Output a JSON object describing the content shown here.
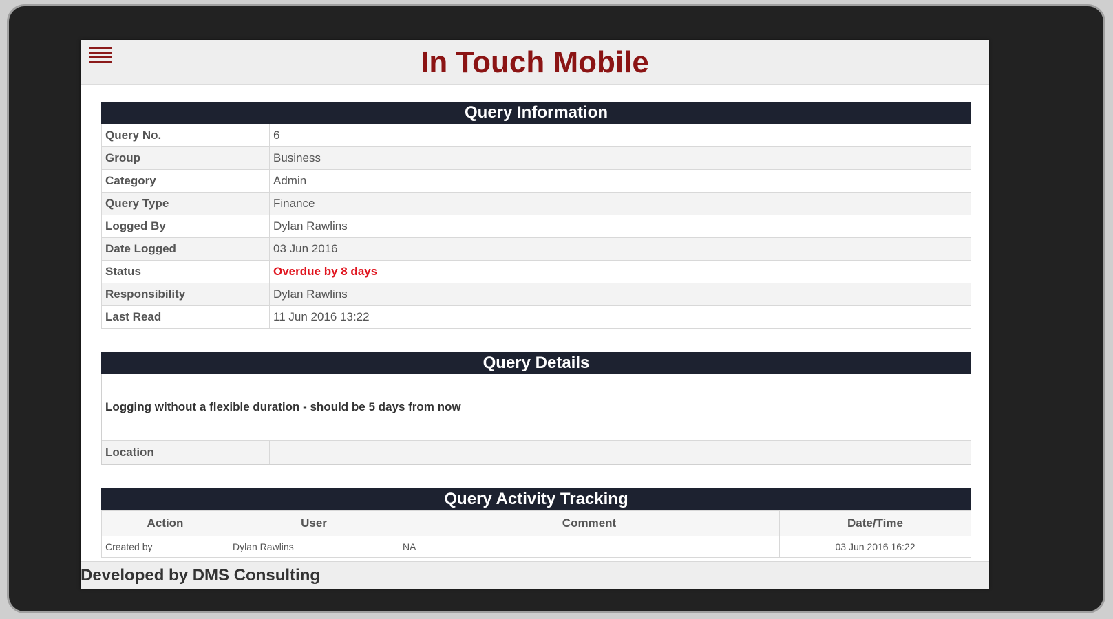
{
  "app": {
    "title": "In Touch Mobile",
    "menu_icon": "hamburger-menu-icon",
    "accent_color": "#8b1414",
    "header_color": "#1d2230"
  },
  "query_information": {
    "header": "Query Information",
    "rows": [
      {
        "label": "Query No.",
        "value": "6"
      },
      {
        "label": "Group",
        "value": "Business"
      },
      {
        "label": "Category",
        "value": "Admin"
      },
      {
        "label": "Query Type",
        "value": "Finance"
      },
      {
        "label": "Logged By",
        "value": "Dylan Rawlins"
      },
      {
        "label": "Date Logged",
        "value": "03 Jun 2016"
      },
      {
        "label": "Status",
        "value": "Overdue by 8 days"
      },
      {
        "label": "Responsibility",
        "value": "Dylan Rawlins"
      },
      {
        "label": "Last Read",
        "value": "11 Jun 2016 13:22"
      }
    ]
  },
  "query_details": {
    "header": "Query Details",
    "description": "Logging without a flexible duration - should be 5 days from now",
    "location_label": "Location",
    "location_value": ""
  },
  "activity_tracking": {
    "header": "Query Activity Tracking",
    "columns": [
      "Action",
      "User",
      "Comment",
      "Date/Time"
    ],
    "rows": [
      {
        "action": "Created by",
        "user": "Dylan Rawlins",
        "comment": "NA",
        "datetime": "03 Jun 2016 16:22"
      }
    ]
  },
  "footer": {
    "text": "Developed by DMS Consulting"
  }
}
